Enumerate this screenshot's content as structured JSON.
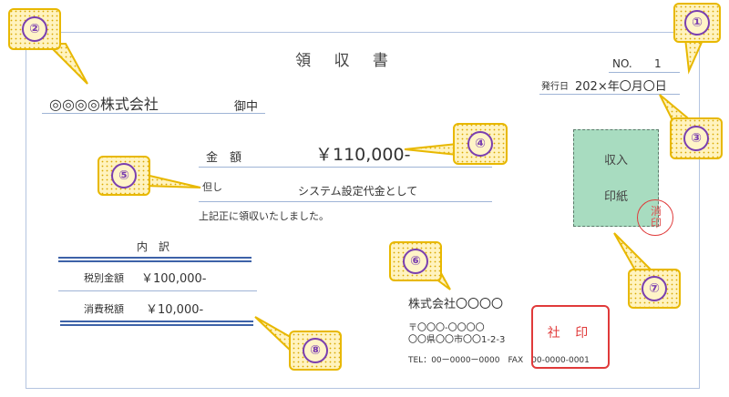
{
  "title": "領 収 書",
  "number": {
    "label": "NO.",
    "value": "1"
  },
  "issue_date": {
    "label": "発行日",
    "value": "202×年〇月〇日"
  },
  "recipient": {
    "name": "◎◎◎◎株式会社",
    "honorific": "御中"
  },
  "amount": {
    "label": "金　額",
    "value": "￥110,000-"
  },
  "proviso": {
    "label": "但し",
    "value": "システム設定代金として"
  },
  "received_note": "上記正に領収いたしました。",
  "breakdown": {
    "title": "内　訳",
    "rows": [
      {
        "label": "税別金額",
        "value": "￥100,000-"
      },
      {
        "label": "消費税額",
        "value": "￥10,000-"
      }
    ]
  },
  "stamp": {
    "line1": "収入",
    "line2": "印紙",
    "cancel1": "消",
    "cancel2": "印"
  },
  "issuer": {
    "company": "株式会社〇〇〇〇",
    "postal": "〒〇〇〇-〇〇〇〇",
    "address": "〇〇県〇〇市〇〇1-2-3",
    "contact": "TEL：00ー0000ー0000　FAX　00-0000-0001"
  },
  "seal": "社 印",
  "callouts": [
    "①",
    "②",
    "③",
    "④",
    "⑤",
    "⑥",
    "⑦",
    "⑧"
  ],
  "colors": {
    "callout_fill": "#ffd966",
    "callout_border": "#e8b800",
    "callout_text": "#7a3fb0",
    "stamp": "#a8dcc0",
    "seal": "#e03a3a",
    "rule": "#3d62a8"
  }
}
